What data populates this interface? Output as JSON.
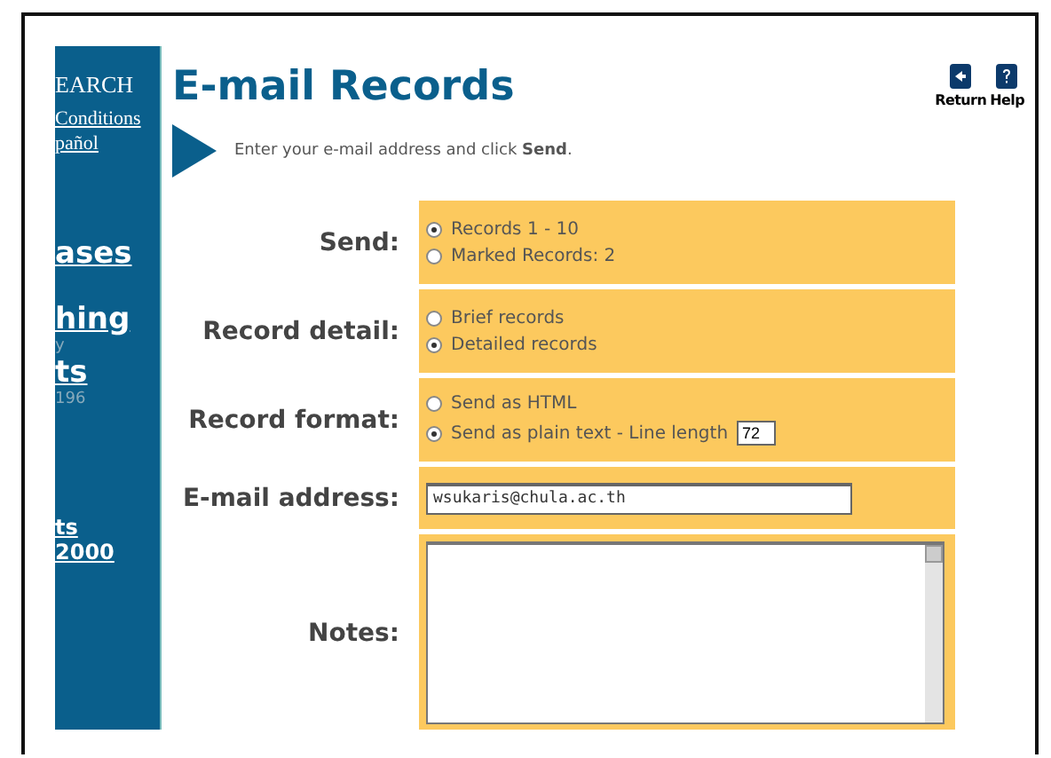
{
  "sidebar": {
    "items": [
      {
        "label": "EARCH",
        "kind": "heading"
      },
      {
        "label": "Conditions",
        "kind": "link"
      },
      {
        "label": "pañol",
        "kind": "link"
      },
      {
        "label": "ases",
        "kind": "section"
      },
      {
        "label": "hing",
        "kind": "section"
      },
      {
        "label": "y",
        "kind": "note"
      },
      {
        "label": "ts",
        "kind": "section"
      },
      {
        "label": "196",
        "kind": "note"
      },
      {
        "label": "ts",
        "kind": "small"
      },
      {
        "label": "2000",
        "kind": "small"
      }
    ]
  },
  "page": {
    "title": "E-mail Records",
    "tools": [
      {
        "label": "Return",
        "kind": "return"
      },
      {
        "label": "Help",
        "kind": "help"
      }
    ],
    "instruction": "Enter your e-mail address and click **Send**."
  },
  "form": {
    "rows": [
      {
        "label": "Send:",
        "kind": "radios",
        "options": [
          {
            "label": "Records 1 - 10",
            "selected": true
          },
          {
            "label": "Marked Records: 2",
            "selected": false
          }
        ]
      },
      {
        "label": "Record detail:",
        "kind": "radios",
        "options": [
          {
            "label": "Brief records",
            "selected": false
          },
          {
            "label": "Detailed records",
            "selected": true
          }
        ]
      },
      {
        "label": "Record format:",
        "kind": "radios",
        "options": [
          {
            "label": "Send as HTML",
            "selected": false
          },
          {
            "label": "Send as plain text -  Line length",
            "selected": true,
            "field_value": "72"
          }
        ]
      },
      {
        "label": "E-mail address:",
        "kind": "text",
        "value": "wsukaris@chula.ac.th"
      },
      {
        "label": "Notes:",
        "kind": "textarea"
      }
    ]
  }
}
